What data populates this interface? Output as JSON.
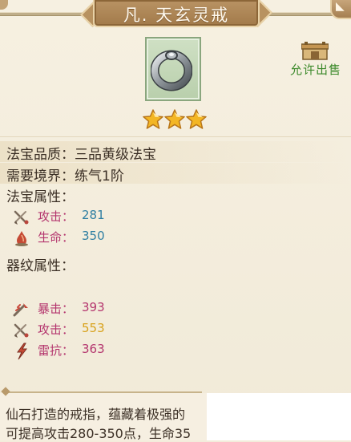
{
  "title": "凡. 天玄灵戒",
  "item": {
    "icon": "ring-icon",
    "star_count": 3,
    "sell_label": "允许出售"
  },
  "info": {
    "quality_key": "法宝品质：",
    "quality_value": "三品黄级法宝",
    "realm_key": "需要境界：",
    "realm_value": "练气1阶"
  },
  "base_attrs": {
    "heading": "法宝属性：",
    "rows": [
      {
        "icon": "attack-icon",
        "label": "攻击：",
        "value": "281",
        "color": "#2f7fa2"
      },
      {
        "icon": "health-icon",
        "label": "生命：",
        "value": "350",
        "color": "#2f7fa2"
      }
    ]
  },
  "pattern_attrs": {
    "heading": "器纹属性：",
    "rows": [
      {
        "icon": "crit-icon",
        "label": "暴击：",
        "value": "393",
        "color": "#b4366e"
      },
      {
        "icon": "attack-icon",
        "label": "攻击：",
        "value": "553",
        "color": "#d8a21c"
      },
      {
        "icon": "thunder-resist-icon",
        "label": "雷抗：",
        "value": "363",
        "color": "#b4366e"
      }
    ]
  },
  "description": {
    "line1": "仙石打造的戒指，蕴藏着极强的",
    "line2": "可提高攻击280-350点，生命35"
  },
  "colors": {
    "label_pink": "#b4366e",
    "value_blue": "#2f7fa2",
    "value_gold": "#d8a21c",
    "sell_green": "#3d8a2c",
    "title_plate": "#a27a4a"
  }
}
